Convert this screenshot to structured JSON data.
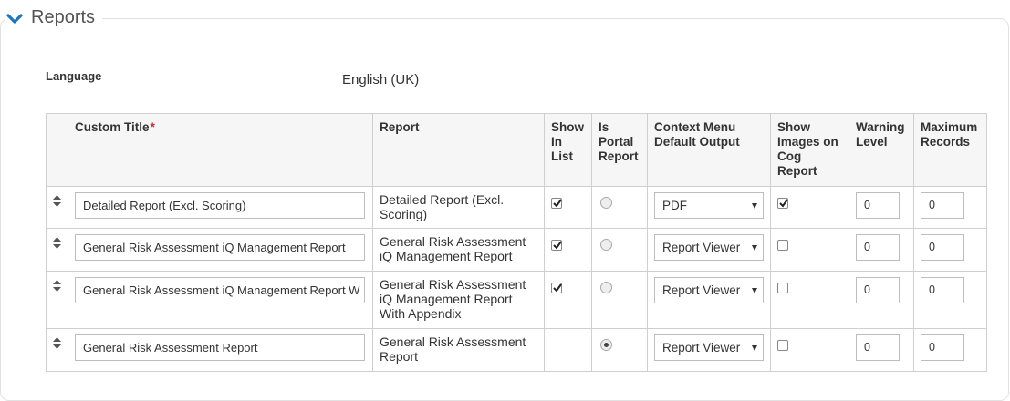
{
  "section": {
    "title": "Reports",
    "expand_icon": "chevron-down-icon",
    "accent": "#1a75c2"
  },
  "language": {
    "label": "Language",
    "value": "English (UK)"
  },
  "table": {
    "headers": {
      "custom_title": "Custom Title",
      "required_marker": "*",
      "report": "Report",
      "show_in_list": "Show In List",
      "is_portal_report": "Is Portal Report",
      "context_menu": "Context Menu Default Output",
      "show_images": "Show Images on Cog Report",
      "warning_level": "Warning Level",
      "maximum_records": "Maximum Records"
    },
    "rows": [
      {
        "custom_title": "Detailed Report (Excl. Scoring)",
        "report": "Detailed Report (Excl. Scoring)",
        "show_in_list": true,
        "is_portal_report": false,
        "context_menu": "PDF",
        "show_images": true,
        "warning_level": "0",
        "maximum_records": "0"
      },
      {
        "custom_title": "General Risk Assessment iQ Management Report",
        "report": "General Risk Assessment iQ Management Report",
        "show_in_list": true,
        "is_portal_report": false,
        "context_menu": "Report Viewer",
        "show_images": false,
        "warning_level": "0",
        "maximum_records": "0"
      },
      {
        "custom_title": "General Risk Assessment iQ Management Report W",
        "report": "General Risk Assessment iQ Management Report With Appendix",
        "show_in_list": true,
        "is_portal_report": false,
        "context_menu": "Report Viewer",
        "show_images": false,
        "warning_level": "0",
        "maximum_records": "0"
      },
      {
        "custom_title": "General Risk Assessment Report",
        "report": "General Risk Assessment Report",
        "show_in_list": false,
        "is_portal_report": true,
        "context_menu": "Report Viewer",
        "show_images": false,
        "warning_level": "0",
        "maximum_records": "0"
      }
    ]
  }
}
